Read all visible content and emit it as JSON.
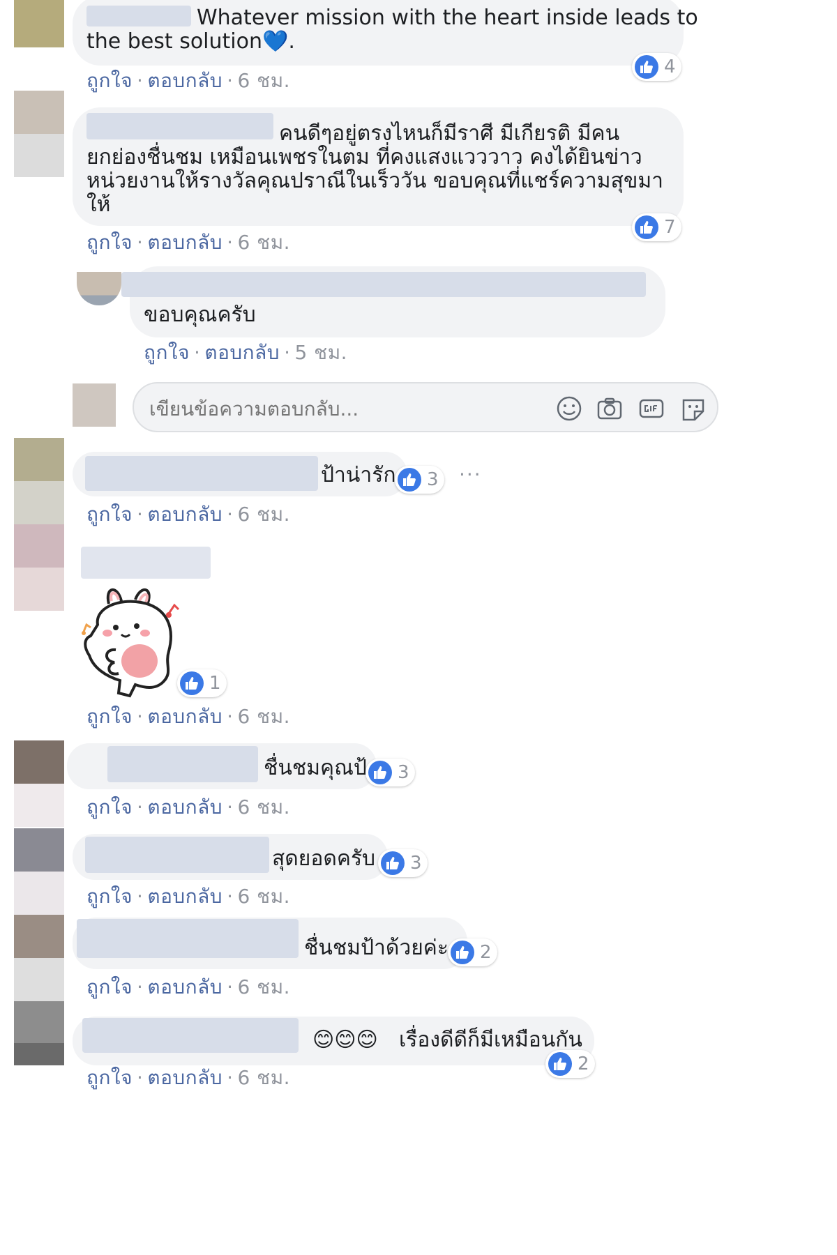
{
  "comments": [
    {
      "text_lines": [
        "Whatever mission with the heart inside leads to",
        "the best solution"
      ],
      "trailing_emoji": "💙",
      "likes": "4"
    },
    {
      "text_lines": [
        "คนดีๆอยู่ตรงไหนก็มีราศี มีเกียรติ มีคน",
        "ยกย่องชื่นชม เหมือนเพชรในตม ที่คงแสงแวววาว คงได้ยินข่าว",
        "หน่วยงานให้รางวัลคุณปราณีในเร็ววัน ขอบคุณที่แชร์ความสุขมา",
        "ให้"
      ],
      "likes": "7"
    },
    {
      "text": "ป้าน่ารัก",
      "likes": "3",
      "more": "···"
    },
    {
      "likes": "1"
    },
    {
      "text": "ชื่นชมคุณป้า",
      "likes": "3"
    },
    {
      "text": "สุดยอดครับ",
      "likes": "3"
    },
    {
      "text": "ชื่นชมป้าด้วยค่ะ",
      "likes": "2"
    },
    {
      "emojis": "😊😊😊",
      "text": "เรื่องดีดีก็มีเหมือนกัน",
      "likes": "2"
    }
  ],
  "reply": {
    "text": "ขอบคุณครับ",
    "time": "5 ชม."
  },
  "actions": {
    "like": "ถูกใจ",
    "reply": "ตอบกลับ",
    "separator": "·",
    "time": "6 ชม."
  },
  "reply_box": {
    "placeholder": "เขียนข้อความตอบกลับ...",
    "icons": [
      "emoji-icon",
      "camera-icon",
      "gif-icon",
      "sticker-icon"
    ]
  },
  "colors": {
    "link": "#4b67a1",
    "like_badge": "#3b79e6",
    "bubble": "#f2f3f5",
    "meta": "#90949c"
  }
}
